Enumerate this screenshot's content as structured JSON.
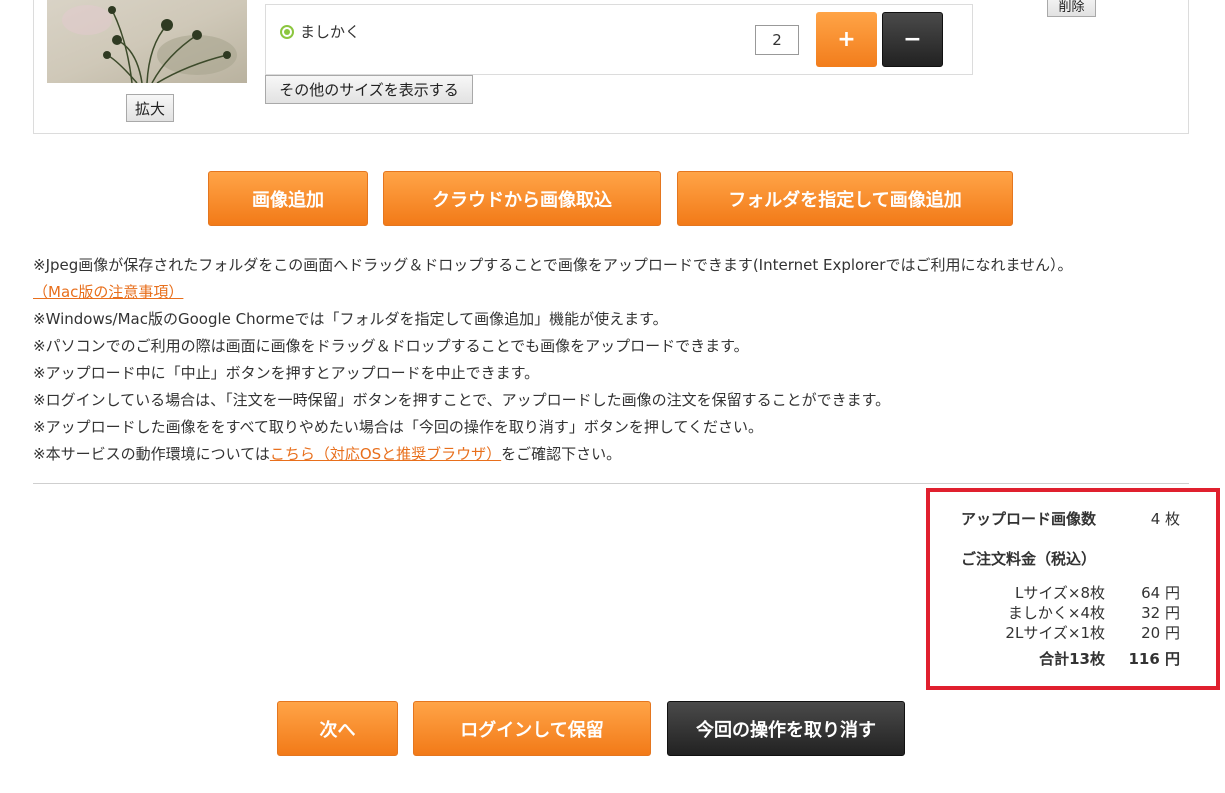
{
  "photo": {
    "zoom_label": "拡大",
    "delete_label": "削除",
    "size_label": "ましかく",
    "quantity": "2",
    "plus_label": "+",
    "minus_label": "−",
    "other_sizes_label": "その他のサイズを表示する"
  },
  "actions": {
    "add_image": "画像追加",
    "cloud_import": "クラウドから画像取込",
    "folder_add": "フォルダを指定して画像追加"
  },
  "notes": {
    "line1": "※Jpeg画像が保存されたフォルダをこの画面へドラッグ＆ドロップすることで画像をアップロードできます(Internet Explorerではご利用になれません）。",
    "mac_link": "（Mac版の注意事項）",
    "line2": "※Windows/Mac版のGoogle Chormeでは「フォルダを指定して画像追加」機能が使えます。",
    "line3": "※パソコンでのご利用の際は画面に画像をドラッグ＆ドロップすることでも画像をアップロードできます。",
    "line4": "※アップロード中に「中止」ボタンを押すとアップロードを中止できます。",
    "line5": "※ログインしている場合は、「注文を一時保留」ボタンを押すことで、アップロードした画像の注文を保留することができます。",
    "line6": "※アップロードした画像ををすべて取りやめたい場合は「今回の操作を取り消す」ボタンを押してください。",
    "line7_prefix": "※本サービスの動作環境については",
    "line7_link": "こちら（対応OSと推奨ブラウザ）",
    "line7_suffix": "をご確認下さい。"
  },
  "summary": {
    "upload_count_label": "アップロード画像数",
    "upload_count_value": "4 枚",
    "fee_label": "ご注文料金（税込）",
    "items": [
      {
        "name": "Lサイズ×8枚",
        "price": "64 円"
      },
      {
        "name": "ましかく×4枚",
        "price": "32 円"
      },
      {
        "name": "2Lサイズ×1枚",
        "price": "20 円"
      }
    ],
    "total_label": "合計13枚",
    "total_value": "116 円",
    "highlight_color": "#e0202e"
  },
  "footer": {
    "next": "次へ",
    "login_save": "ログインして保留",
    "cancel_op": "今回の操作を取り消す"
  },
  "colors": {
    "orange": "#f5891f",
    "dark": "#2b2b2b",
    "link": "#e86f1c"
  }
}
